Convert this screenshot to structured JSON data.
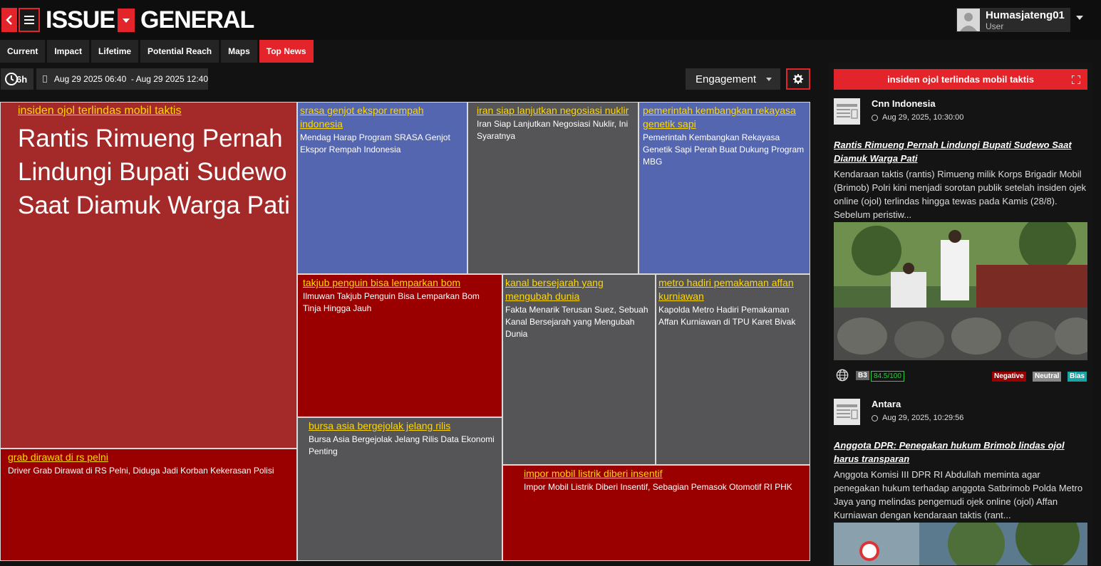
{
  "header": {
    "logo_left": "ISSUE",
    "logo_right": "GENERAL",
    "user_name": "Humasjateng01",
    "user_role": "User"
  },
  "tabs": [
    {
      "label": "Current",
      "active": false
    },
    {
      "label": "Impact",
      "active": false
    },
    {
      "label": "Lifetime",
      "active": false
    },
    {
      "label": "Potential Reach",
      "active": false
    },
    {
      "label": "Maps",
      "active": false
    },
    {
      "label": "Top News",
      "active": true
    }
  ],
  "filters": {
    "period": "6h",
    "date_range": "Aug 29 2025 06:40  - Aug 29 2025 12:40",
    "sort_by": "Engagement"
  },
  "treemap": {
    "tiles": [
      {
        "title": "insiden ojol terlindas mobil taktis",
        "headline": "Rantis Rimueng Pernah Lindungi Bupati Sudewo Saat Diamuk Warga Pati",
        "color": "#a42a2a"
      },
      {
        "title": "grab dirawat di rs pelni",
        "subtitle": "Driver Grab Dirawat di RS Pelni, Diduga Jadi Korban Kekerasan Polisi",
        "color": "#9b0000"
      },
      {
        "title": "srasa genjot ekspor rempah indonesia",
        "subtitle": "Mendag Harap Program SRASA Genjot Ekspor Rempah Indonesia",
        "color": "#5566b0"
      },
      {
        "title": "iran siap lanjutkan negosiasi nuklir",
        "subtitle": "Iran Siap Lanjutkan Negosiasi Nuklir, Ini Syaratnya",
        "color": "#555557"
      },
      {
        "title": "pemerintah kembangkan rekayasa genetik sapi",
        "subtitle": "Pemerintah Kembangkan Rekayasa Genetik Sapi Perah Buat Dukung Program MBG",
        "color": "#5566b0"
      },
      {
        "title": "takjub penguin bisa lemparkan bom",
        "subtitle": "Ilmuwan Takjub Penguin Bisa Lemparkan Bom Tinja Hingga Jauh",
        "color": "#9b0000"
      },
      {
        "title": "kanal bersejarah yang mengubah dunia",
        "subtitle": "Fakta Menarik Terusan Suez, Sebuah Kanal Bersejarah yang Mengubah Dunia",
        "color": "#555557"
      },
      {
        "title": "metro hadiri pemakaman affan kurniawan",
        "subtitle": "Kapolda Metro Hadiri Pemakaman Affan Kurniawan di TPU Karet Bivak",
        "color": "#555557"
      },
      {
        "title": "bursa asia bergejolak jelang rilis",
        "subtitle": "Bursa Asia Bergejolak Jelang Rilis Data Ekonomi Penting",
        "color": "#555557"
      },
      {
        "title": "impor mobil listrik diberi insentif",
        "subtitle": "Impor Mobil Listrik Diberi Insentif, Sebagian Pemasok Otomotif RI PHK",
        "color": "#9b0000"
      }
    ]
  },
  "panel": {
    "header": "insiden ojol terlindas mobil taktis",
    "articles": [
      {
        "source": "Cnn Indonesia",
        "time": "Aug 29, 2025, 10:30:00",
        "title": "Rantis Rimueng Pernah Lindungi Bupati Sudewo Saat Diamuk Warga Pati",
        "body": "Kendaraan taktis (rantis) Rimueng milik Korps Brigadir Mobil (Brimob) Polri kini menjadi sorotan publik setelah insiden ojek online (ojol) terlindas hingga tewas pada Kamis (28/8). Sebelum peristiw...",
        "badge": "B3",
        "score": "84.5/100",
        "tags": [
          "Negative",
          "Neutral",
          "Bias"
        ]
      },
      {
        "source": "Antara",
        "time": "Aug 29, 2025, 10:29:56",
        "title": "Anggota DPR: Penegakan hukum Brimob lindas ojol harus transparan",
        "body": "Anggota Komisi III DPR RI Abdullah meminta agar penegakan hukum terhadap anggota Satbrimob Polda Metro Jaya yang melindas pengemudi ojek online (ojol) Affan Kurniawan dengan kendaraan taktis (rant..."
      }
    ]
  },
  "colors": {
    "accent": "#e3242b",
    "negative": "#9b0000",
    "neutral": "#888888",
    "bias": "#1aa3a3",
    "score": "#2ecc40"
  },
  "icons": [
    "back-arrow-icon",
    "hamburger-menu-icon",
    "chevron-down-icon",
    "avatar-icon",
    "clock-icon",
    "calendar-icon",
    "gear-icon",
    "expand-icon",
    "newspaper-icon",
    "globe-icon"
  ]
}
